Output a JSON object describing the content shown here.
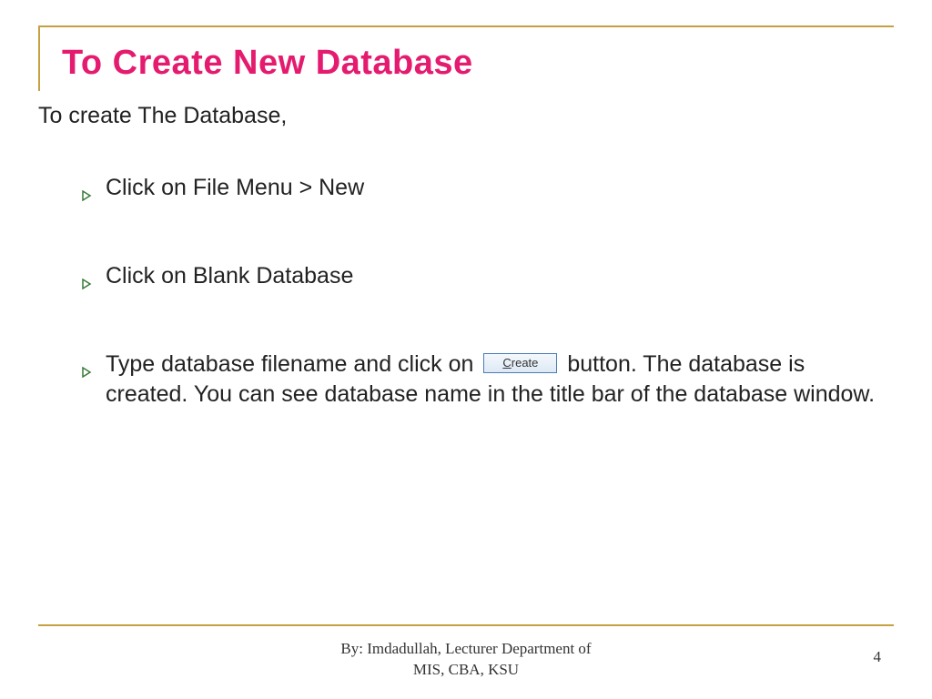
{
  "title": "To Create New Database",
  "intro": "To create The Database,",
  "bullets": {
    "item1": "Click on File Menu > New",
    "item2": "Click on Blank Database",
    "item3_before": "Type database filename and click on ",
    "item3_button": "reate",
    "item3_button_prefix": "C",
    "item3_after": " button. The database is created. You can see database name in the title bar of the database window."
  },
  "footer": {
    "line1": "By: Imdadullah, Lecturer Department of",
    "line2": "MIS, CBA, KSU"
  },
  "page_number": "4"
}
